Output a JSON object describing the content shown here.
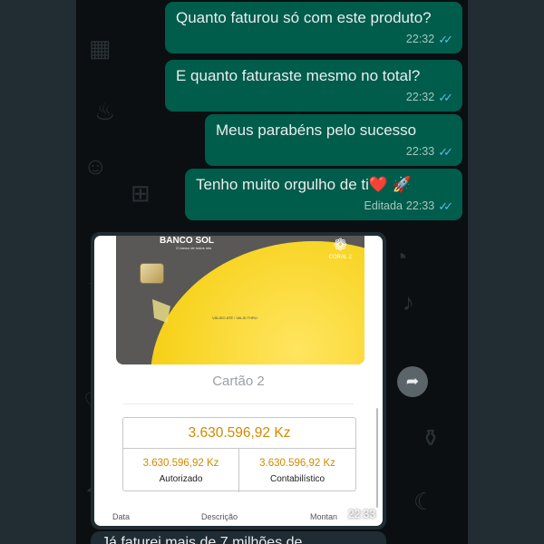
{
  "messages": [
    {
      "text": "Quanto faturou só com este produto?",
      "time": "22:32",
      "edited_label": ""
    },
    {
      "text": "E quanto faturaste mesmo no total?",
      "time": "22:32",
      "edited_label": ""
    },
    {
      "text": "Meus parabéns pelo sucesso",
      "time": "22:33",
      "edited_label": ""
    },
    {
      "text": "Tenho muito orgulho de ti❤️ 🚀",
      "time": "22:33",
      "edited_label": "Editada"
    }
  ],
  "image_message": {
    "time": "22:33",
    "card": {
      "brand": "BANCO SOL",
      "brand_sub": "O banco de todos nós",
      "logo_text": "CORAL 2",
      "valid_label": "VÁLIDO ATÉ / VALID THRU"
    },
    "card_title": "Cartão 2",
    "summary": {
      "total": "3.630.596,92 Kz",
      "authorized_value": "3.630.596,92 Kz",
      "authorized_label": "Autorizado",
      "accounting_value": "3.630.596,92 Kz",
      "accounting_label": "Contabilístico"
    },
    "table_headers": [
      "Data",
      "Descrição",
      "Montan"
    ]
  },
  "partial_message_text": "Já faturei mais de 7 milhões de",
  "icons": {
    "tick": "double-check-read-icon",
    "share": "forward-share-icon"
  },
  "colors": {
    "outgoing_bubble": "#005c4b",
    "incoming_bubble": "#202c33",
    "read_ticks": "#53bdeb",
    "amount": "#d18a00"
  }
}
